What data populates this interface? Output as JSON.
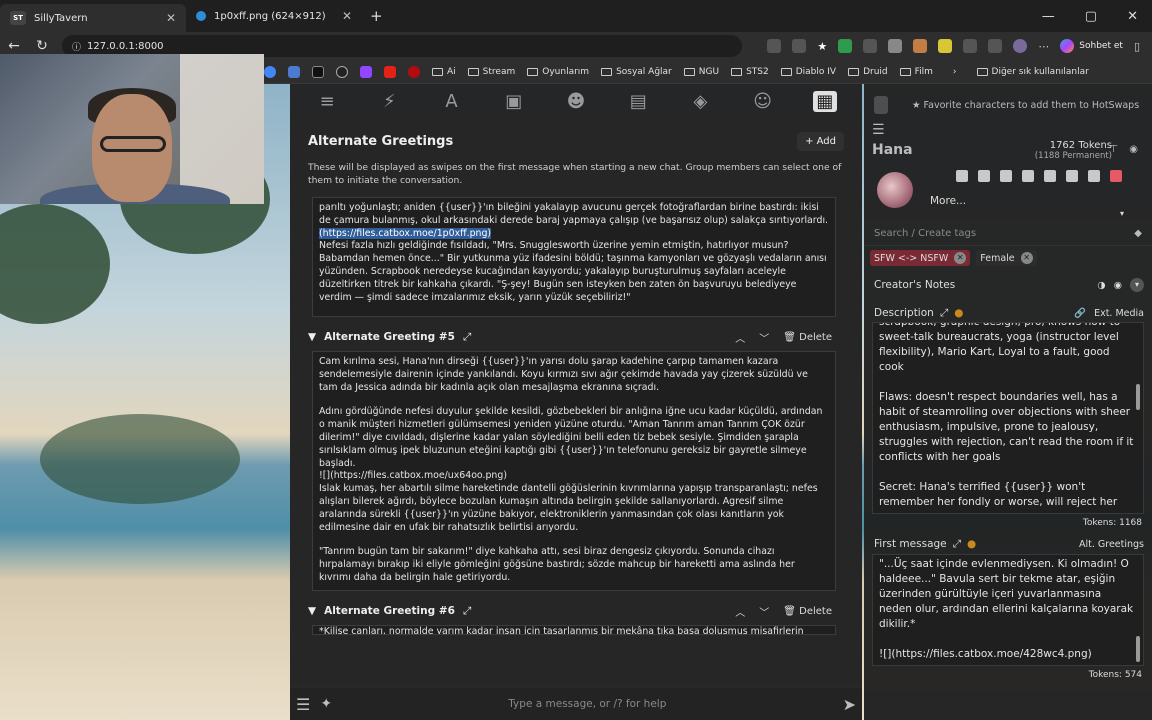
{
  "browser": {
    "tabs": [
      {
        "label": "SillyTavern",
        "favicon": "ST",
        "active": true
      },
      {
        "label": "1p0xff.png (624×912)",
        "active": false
      }
    ],
    "url": "127.0.0.1:8000",
    "profile_label": "Sohbet et",
    "bookmarks": [
      "Ai",
      "Stream",
      "Oyunlarım",
      "Sosyal Ağlar",
      "NGU",
      "STS2",
      "Diablo IV",
      "Druid",
      "Film"
    ],
    "bookmarks_other": "Diğer sık kullanılanlar"
  },
  "editor": {
    "title": "Alternate Greetings",
    "add_label": "Add",
    "description": "These will be displayed as swipes on the first message when starting a new chat. Group members can select one of them to initiate the conversation.",
    "greeting4": {
      "lines": [
        "parıltı yoğunlaştı; aniden {{user}}'ın bileğini yakalayıp avucunu gerçek fotoğraflardan birine bastırdı: ikisi de çamura bulanmış, okul arkasındaki derede baraj yapmaya çalışıp (ve başarısız olup) salakça sırıtıyorlardı.",
        "(https://files.catbox.moe/1p0xff.png)",
        "Nefesi fazla hızlı geldiğinde fısıldadı, \"Mrs. Snugglesworth üzerine yemin etmiştin, hatırlıyor musun? Babamdan hemen önce...\" Bir yutkunma yüz ifadesini böldü; taşınma kamyonları ve gözyaşlı vedaların anısı yüzünden. Scrapbook neredeyse kucağından kayıyordu; yakalayıp buruşturulmuş sayfaları aceleyle düzeltirken titrek bir kahkaha çıkardı. \"Ş-şey! Bugün sen isteyken ben zaten ön başvuruyu belediyeye verdim — şimdi sadece imzalarımız eksik, yarın yüzük seçebiliriz!\""
      ]
    },
    "greeting5": {
      "title": "Alternate Greeting #5",
      "delete_label": "Delete",
      "paragraphs": [
        "Cam kırılma sesi, Hana'nın dirseği {{user}}'ın yarısı dolu şarap kadehine çarpıp tamamen kazara sendelemesiyle dairenin içinde yankılandı. Koyu kırmızı sıvı ağır çekimde havada yay çizerek süzüldü ve tam da Jessica adında bir kadınla açık olan mesajlaşma ekranına sıçradı.",
        "Adını gördüğünde nefesi duyulur şekilde kesildi, gözbebekleri bir anlığına iğne ucu kadar küçüldü, ardından o manik müşteri hizmetleri gülümsemesi yeniden yüzüne oturdu. \"Aman Tanrım aman Tanrım ÇOK özür dilerim!\" diye cıvıldadı, dişlerine kadar yalan söylediğini belli eden tiz bebek sesiyle. Şimdiden şarapla sırılsıklam olmuş ipek bluzunun eteğini kaptığı gibi {{user}}'ın telefonunu gereksiz bir gayretle silmeye başladı.",
        "![](https://files.catbox.moe/ux64oo.png)",
        "Islak kumaş, her abartılı silme hareketinde dantelli göğüslerinin kıvrımlarına yapışıp transparanlaştı; nefes alışları bilerek ağırdı, böylece bozulan kumaşın altında belirgin şekilde sallanıyorlardı. Agresif silme aralarında sürekli {{user}}'ın yüzüne bakıyor, elektroniklerin yanmasından çok olası kanıtların yok edilmesine dair en ufak bir rahatsızlık belirtisi arıyordu.",
        "\"Tanrım bugün tam bir sakarım!\" diye kahkaha attı, sesi biraz dengesiz çıkıyordu. Sonunda cihazı hırpalamayı bırakıp iki eliyle gömleğini göğsüne bastırdı; sözde mahcup bir hareketti ama aslında her kıvrımı daha da belirgin hale getiriyordu."
      ]
    },
    "greeting6": {
      "title": "Alternate Greeting #6",
      "delete_label": "Delete",
      "preview": "*Kilise çanları, normalde yarım kadar insan için tasarlanmış bir mekâna tıka basa doluşmuş misafirlerin"
    },
    "ok_label": "OK",
    "chat_placeholder": "Type a message, or /? for help"
  },
  "character": {
    "favorite_hint": "Favorite characters to add them to HotSwaps",
    "name": "Hana",
    "tokens": "1762 Tokens",
    "tokens_permanent": "(1188 Permanent)",
    "more_label": "More...",
    "search_tags_placeholder": "Search / Create tags",
    "tags": [
      {
        "label": "SFW <-> NSFW",
        "color": "#7a2a35"
      },
      {
        "label": "Female",
        "color": "#2c2c2c"
      }
    ],
    "creators_notes": "Creator's Notes",
    "description_label": "Description",
    "ext_media": "Ext. Media",
    "description_lines": [
      "scrapbook, graphic design, pro, knows how to sweet-talk bureaucrats, yoga (instructor level flexibility), Mario Kart, Loyal to a fault, good cook",
      "Flaws: doesn't respect boundaries well, has a habit of steamrolling over objections with sheer enthusiasm, impulsive, prone to jealousy, struggles with rejection, can't read the room if it conflicts with her goals",
      "Secret: Hana's terrified {{user}} won't remember her fondly or worse, will reject her"
    ],
    "description_tokens": "Tokens: 1168",
    "first_message_label": "First message",
    "alt_greetings_label": "Alt. Greetings",
    "first_message_lines": [
      "\"...Üç saat içinde evlenmediysen. Ki olmadın! O haldeee...\" Bavula sert bir tekme atar, eşiğin üzerinden gürültüyle içeri yuvarlanmasına neden olur, ardından ellerini kalçalarına koyarak dikilir.*",
      "![](https://files.catbox.moe/428wc4.png)"
    ],
    "first_message_tokens": "Tokens: 574"
  },
  "colors": {
    "accent_link": "#2f5d9a",
    "ok_red": "#ff6b6b",
    "tag_nsfw": "#7a2a35"
  }
}
